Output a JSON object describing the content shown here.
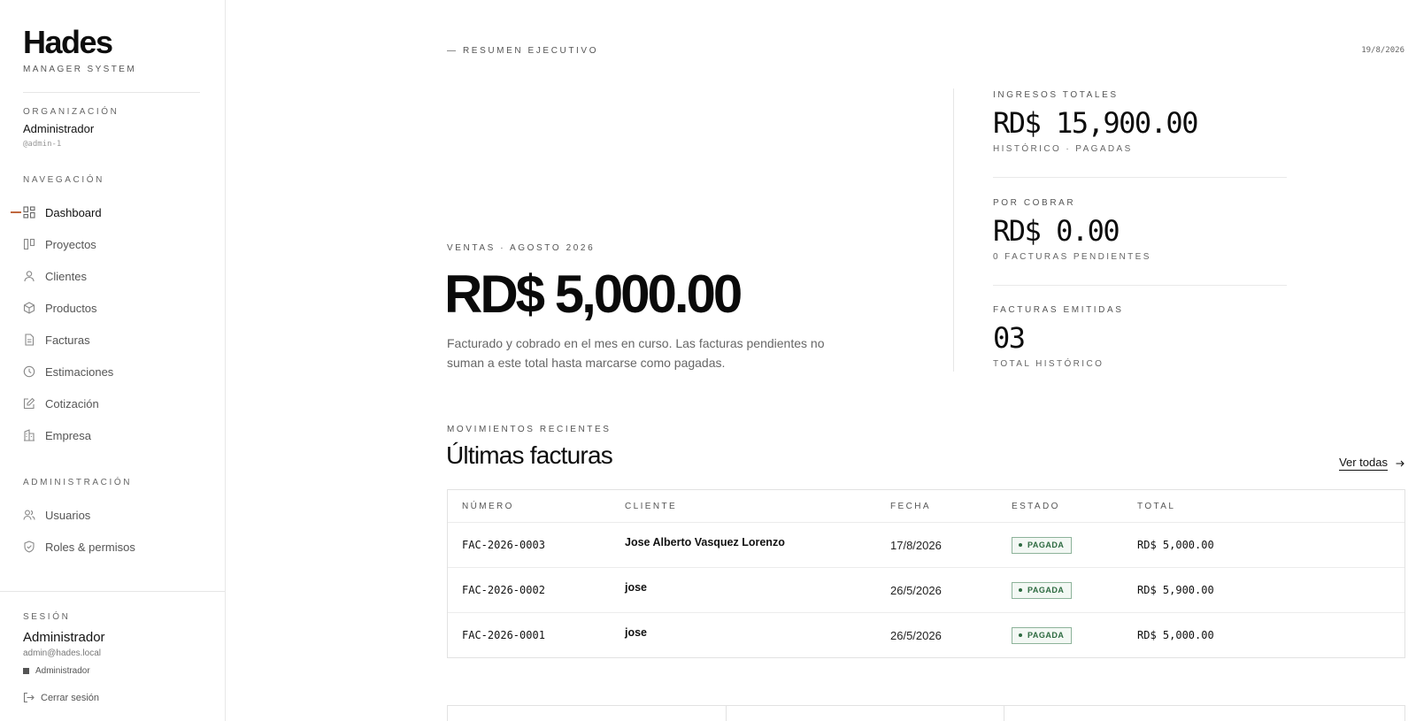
{
  "brand": {
    "name": "Hades",
    "subtitle": "MANAGER SYSTEM"
  },
  "organization": {
    "label": "ORGANIZACIÓN",
    "name": "Administrador",
    "handle": "@admin-1"
  },
  "navigation": {
    "label": "NAVEGACIÓN",
    "items": [
      {
        "label": "Dashboard",
        "icon": "dashboard-icon",
        "active": true
      },
      {
        "label": "Proyectos",
        "icon": "kanban-icon"
      },
      {
        "label": "Clientes",
        "icon": "user-icon"
      },
      {
        "label": "Productos",
        "icon": "box-icon"
      },
      {
        "label": "Facturas",
        "icon": "document-icon"
      },
      {
        "label": "Estimaciones",
        "icon": "clock-icon"
      },
      {
        "label": "Cotización",
        "icon": "edit-icon"
      },
      {
        "label": "Empresa",
        "icon": "building-icon"
      }
    ]
  },
  "administration": {
    "label": "ADMINISTRACIÓN",
    "items": [
      {
        "label": "Usuarios",
        "icon": "users-icon"
      },
      {
        "label": "Roles & permisos",
        "icon": "shield-icon"
      }
    ]
  },
  "session": {
    "label": "SESIÓN",
    "name": "Administrador",
    "email": "admin@hades.local",
    "role": "Administrador",
    "logout": "Cerrar sesión"
  },
  "header": {
    "eyebrow": "— RESUMEN EJECUTIVO",
    "date": "19/8/2026"
  },
  "sales": {
    "label": "VENTAS · AGOSTO 2026",
    "value": "RD$ 5,000.00",
    "description": "Facturado y cobrado en el mes en curso. Las facturas pendientes no suman a este total hasta marcarse como pagadas."
  },
  "kpis": [
    {
      "label": "INGRESOS TOTALES",
      "value": "RD$ 15,900.00",
      "sub": "HISTÓRICO · PAGADAS"
    },
    {
      "label": "POR COBRAR",
      "value": "RD$ 0.00",
      "sub": "0 FACTURAS PENDIENTES"
    },
    {
      "label": "FACTURAS EMITIDAS",
      "value": "03",
      "sub": "TOTAL HISTÓRICO"
    }
  ],
  "recent": {
    "label": "MOVIMIENTOS RECIENTES",
    "title": "Últimas facturas",
    "see_all": "Ver todas",
    "columns": [
      "NÚMERO",
      "CLIENTE",
      "FECHA",
      "ESTADO",
      "TOTAL"
    ],
    "rows": [
      {
        "number": "FAC-2026-0003",
        "client": "Jose Alberto Vasquez Lorenzo",
        "date": "17/8/2026",
        "status": "PAGADA",
        "total": "RD$ 5,000.00"
      },
      {
        "number": "FAC-2026-0002",
        "client": "jose",
        "date": "26/5/2026",
        "status": "PAGADA",
        "total": "RD$ 5,900.00"
      },
      {
        "number": "FAC-2026-0001",
        "client": "jose",
        "date": "26/5/2026",
        "status": "PAGADA",
        "total": "RD$ 5,000.00"
      }
    ]
  },
  "colors": {
    "accent": "#c0673f",
    "paid_text": "#2d6a40",
    "paid_border": "#8db39a",
    "paid_bg": "#f3f8f4"
  }
}
